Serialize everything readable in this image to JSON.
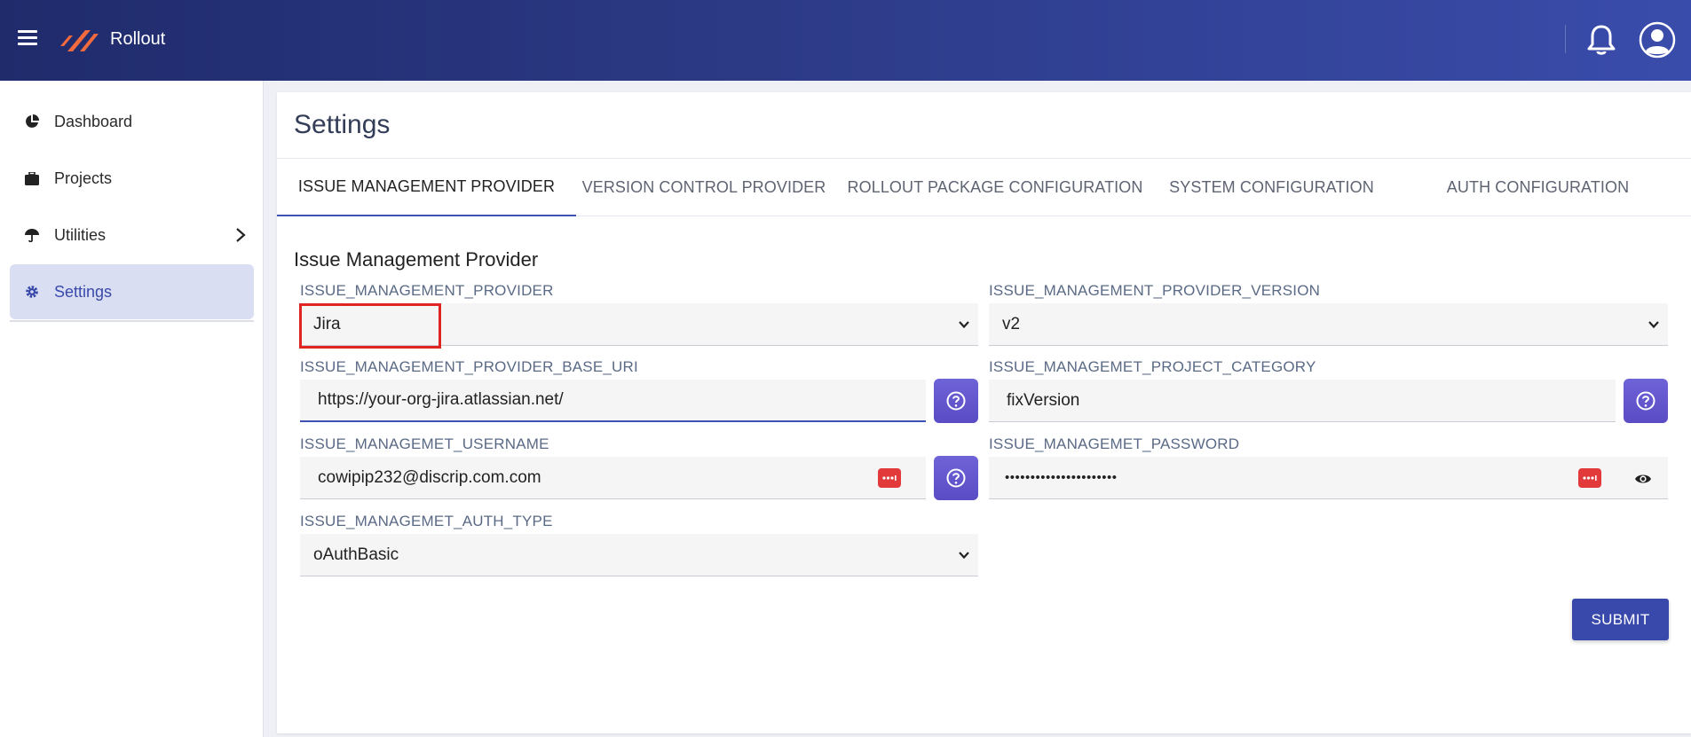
{
  "app": {
    "brand": "Rollout"
  },
  "sidebar": {
    "items": [
      {
        "label": "Dashboard",
        "icon": "pie-chart-icon"
      },
      {
        "label": "Projects",
        "icon": "briefcase-icon"
      },
      {
        "label": "Utilities",
        "icon": "umbrella-icon"
      },
      {
        "label": "Settings",
        "icon": "gear-icon"
      }
    ]
  },
  "page": {
    "title": "Settings"
  },
  "tabs": [
    {
      "label": "ISSUE MANAGEMENT PROVIDER"
    },
    {
      "label": "VERSION CONTROL PROVIDER"
    },
    {
      "label": "ROLLOUT PACKAGE CONFIGURATION"
    },
    {
      "label": "SYSTEM CONFIGURATION"
    },
    {
      "label": "AUTH CONFIGURATION"
    }
  ],
  "form": {
    "section_title": "Issue Management Provider",
    "provider": {
      "label": "ISSUE_MANAGEMENT_PROVIDER",
      "value": "Jira"
    },
    "provider_version": {
      "label": "ISSUE_MANAGEMENT_PROVIDER_VERSION",
      "value": "v2"
    },
    "base_uri": {
      "label": "ISSUE_MANAGEMENT_PROVIDER_BASE_URI",
      "value": "https://your-org-jira.atlassian.net/"
    },
    "project_category": {
      "label": "ISSUE_MANAGEMET_PROJECT_CATEGORY",
      "value": "fixVersion"
    },
    "username": {
      "label": "ISSUE_MANAGEMET_USERNAME",
      "value": "cowipip232@discrip.com.com"
    },
    "password": {
      "label": "ISSUE_MANAGEMET_PASSWORD",
      "value": "••••••••••••••••••••••"
    },
    "auth_type": {
      "label": "ISSUE_MANAGEMET_AUTH_TYPE",
      "value": "oAuthBasic"
    },
    "submit_label": "SUBMIT"
  },
  "colors": {
    "accent": "#3f51b5",
    "help_button": "#6356cf",
    "highlight": "#e02424",
    "password_manager": "#e23a3a"
  }
}
